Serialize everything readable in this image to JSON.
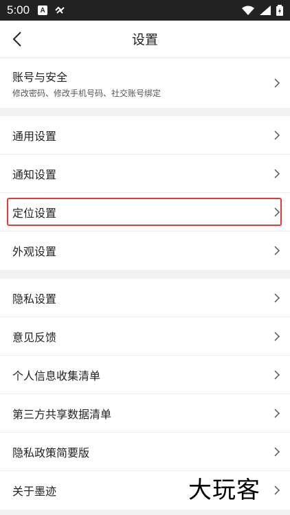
{
  "status_bar": {
    "time": "5:00",
    "badge": "A"
  },
  "header": {
    "title": "设置",
    "back_icon": "chevron-left-icon"
  },
  "account": {
    "label": "账号与安全",
    "sublabel": "修改密码、修改手机号码、社交账号绑定"
  },
  "group_general": [
    "通用设置",
    "通知设置",
    "定位设置",
    "外观设置"
  ],
  "group_privacy": [
    "隐私设置",
    "意见反馈",
    "个人信息收集清单",
    "第三方共享数据清单",
    "隐私政策简要版",
    "关于墨迹"
  ],
  "highlighted_item": "定位设置",
  "watermark": "大玩客",
  "colors": {
    "highlight": "#e53935",
    "background": "#f2f2f2"
  }
}
